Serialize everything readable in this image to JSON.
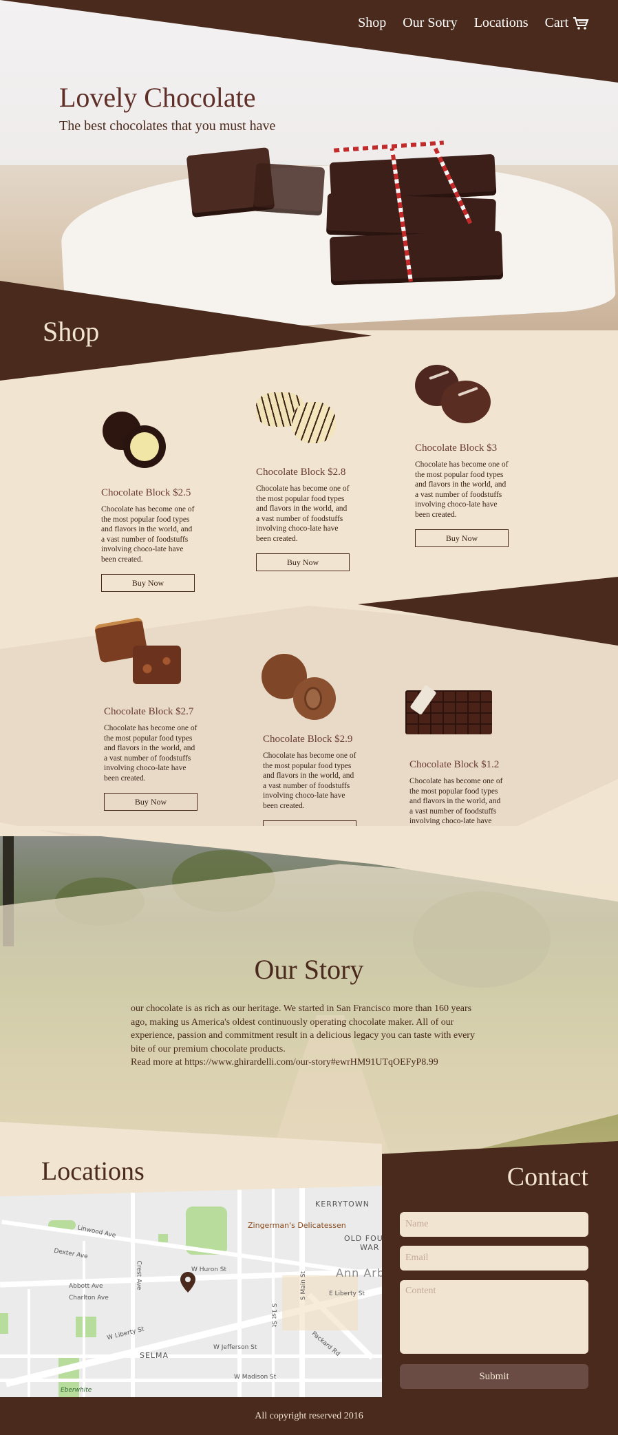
{
  "nav": {
    "items": [
      "Shop",
      "Our Sotry",
      "Locations",
      "Cart"
    ]
  },
  "hero": {
    "title": "Lovely Chocolate",
    "subtitle": "The best chocolates that you must have"
  },
  "shop": {
    "title": "Shop",
    "button_label": "Buy Now",
    "description": "Chocolate has become one of the most popular food types and flavors in the world, and a vast number of foodstuffs involving choco-late have been created.",
    "products": [
      {
        "name": "Chocolate Block $2.5"
      },
      {
        "name": "Chocolate Block $2.8"
      },
      {
        "name": "Chocolate Block $3"
      },
      {
        "name": "Chocolate Block $2.7"
      },
      {
        "name": "Chocolate Block $2.9"
      },
      {
        "name": "Chocolate Block $1.2"
      }
    ]
  },
  "story": {
    "title": "Our Story",
    "text": "our chocolate is as rich as our heritage. We started in San Francisco more than 160 years ago, making us America's oldest continuously operating chocolate maker. All of our experience, passion and commitment result in a delicious legacy you can taste with every bite of our premium chocolate products.",
    "read_more": "Read more at https://www.ghirardelli.com/our-story#ewrHM91UTqOEFyP8.99"
  },
  "locations": {
    "title": "Locations",
    "map_labels": [
      "KERRYTOWN",
      "Zingerman's Delicatessen",
      "OLD FOU",
      "WAR",
      "Linwood Ave",
      "Dexter Ave",
      "W Huron St",
      "Ann Arb",
      "Abbott Ave",
      "Charlton Ave",
      "E Liberty St",
      "Crest Ave",
      "S Main St",
      "S 1st St",
      "W Liberty St",
      "SELMA",
      "W Jefferson St",
      "Packard Rd",
      "W Madison St",
      "Eberwhite"
    ]
  },
  "contact": {
    "title": "Contact",
    "name_placeholder": "Name",
    "email_placeholder": "Email",
    "content_placeholder": "Content",
    "submit_label": "Submit"
  },
  "footer": {
    "text": "All copyright reserved 2016"
  },
  "colors": {
    "brown": "#4a2a1c",
    "cream": "#f1e4d0",
    "accent": "#5e2e27"
  }
}
